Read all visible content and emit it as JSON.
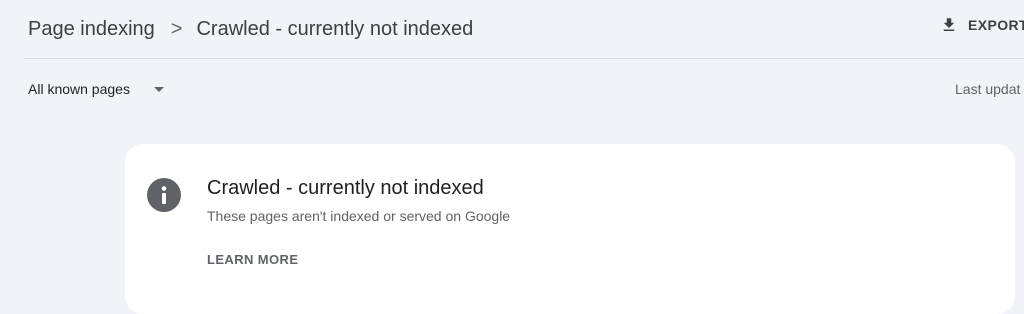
{
  "header": {
    "breadcrumb_parent": "Page indexing",
    "breadcrumb_separator": ">",
    "breadcrumb_current": "Crawled - currently not indexed",
    "export_label": "EXPORT",
    "export_icon": "download-icon"
  },
  "toolbar": {
    "filter_label": "All known pages",
    "filter_icon": "dropdown-caret-icon",
    "last_updated_text": "Last updat"
  },
  "card": {
    "icon": "info-icon",
    "title": "Crawled - currently not indexed",
    "subtitle": "These pages aren't indexed or served on Google",
    "learn_more_label": "LEARN MORE"
  },
  "colors": {
    "page_background": "#f0f4f9",
    "card_background": "#ffffff",
    "icon_fill": "#5f6368",
    "text_primary": "#1f1f1f",
    "text_secondary": "#5f6368"
  }
}
